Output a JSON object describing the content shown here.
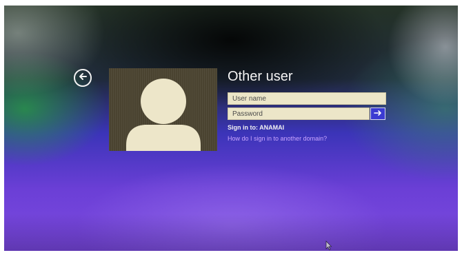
{
  "login": {
    "title": "Other user",
    "username_placeholder": "User name",
    "password_placeholder": "Password",
    "sign_in_to": "Sign in to: ANAMAI",
    "domain_link": "How do I sign in to another domain?"
  },
  "icons": {
    "back": "back-arrow-icon",
    "submit": "right-arrow-icon",
    "avatar": "user-silhouette-icon",
    "cursor": "mouse-pointer-icon"
  },
  "colors": {
    "field_background": "#ece6c8",
    "submit_button": "#3b3bd2",
    "link": "#c9a6ff",
    "text": "#f4f4f4"
  }
}
